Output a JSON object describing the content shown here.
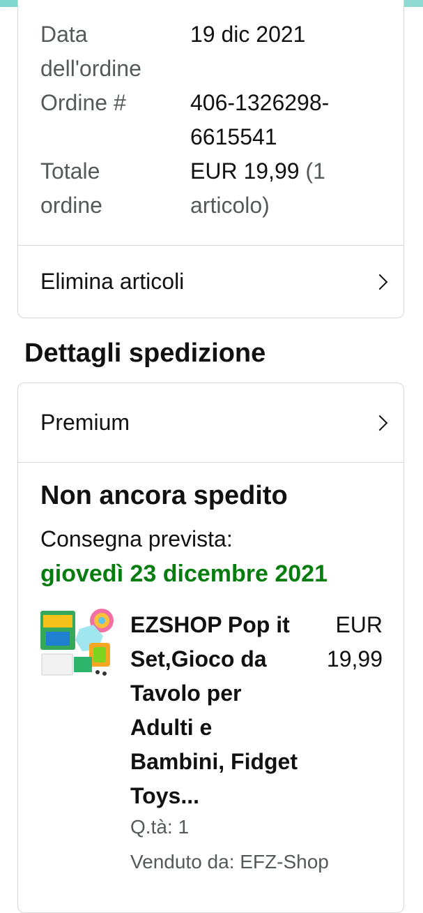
{
  "order_summary": {
    "order_date_label": "Data dell'ordine",
    "order_date_value": "19 dic 2021",
    "order_number_label": "Ordine #",
    "order_number_value": "406-1326298-6615541",
    "order_total_label": "Totale ordine",
    "order_total_value": "EUR 19,99",
    "order_total_items": "(1 articolo)",
    "remove_items_label": "Elimina articoli"
  },
  "shipping": {
    "section_title": "Dettagli spedizione",
    "shipping_type": "Premium",
    "status": "Non ancora spedito",
    "delivery_label": "Consegna prevista:",
    "delivery_date": "giovedì 23 dicembre 2021",
    "delivery_date_color": "#067d0e"
  },
  "product": {
    "title": "EZSHOP Pop it Set,Gioco da Tavolo per Adulti e Bambini, Fidget Toys...",
    "price": "EUR 19,99",
    "quantity": "Q.tà: 1",
    "seller": "Venduto da: EFZ-Shop"
  },
  "colors": {
    "border": "#d5d9d9",
    "muted_text": "#565959",
    "accent_green": "#067d0e"
  }
}
